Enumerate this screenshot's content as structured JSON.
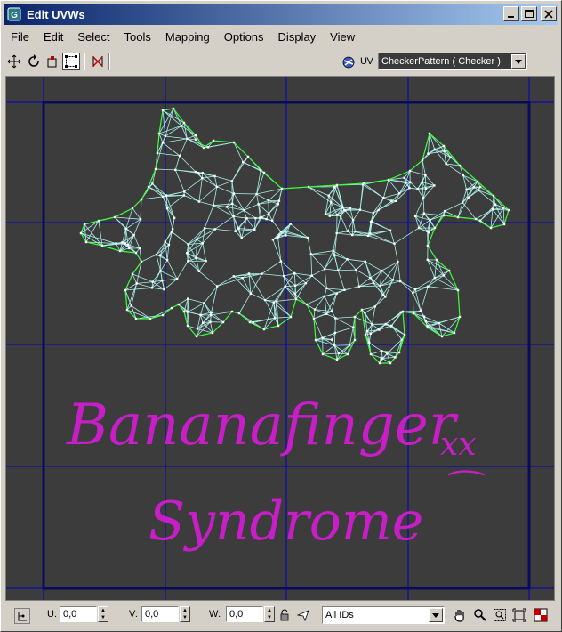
{
  "window": {
    "title": "Edit UVWs"
  },
  "menu": [
    "File",
    "Edit",
    "Select",
    "Tools",
    "Mapping",
    "Options",
    "Display",
    "View"
  ],
  "toolbar": {
    "uv_label": "UV",
    "texture_dropdown": "CheckerPattern  ( Checker )"
  },
  "canvas": {
    "annotation_line1": "Bananafinger",
    "annotation_line2": "Syndrome",
    "annotation_kisses": "xx"
  },
  "status": {
    "u_label": "U:",
    "u_value": "0,0",
    "v_label": "V:",
    "v_value": "0,0",
    "w_label": "W:",
    "w_value": "0,0",
    "ids_dropdown": "All IDs"
  },
  "colors": {
    "grid": "#0000c8",
    "border": "#0a0a5a",
    "mesh_inner": "#a8f0e8",
    "mesh_outline": "#38ff38",
    "annotation": "#c81ec8"
  }
}
